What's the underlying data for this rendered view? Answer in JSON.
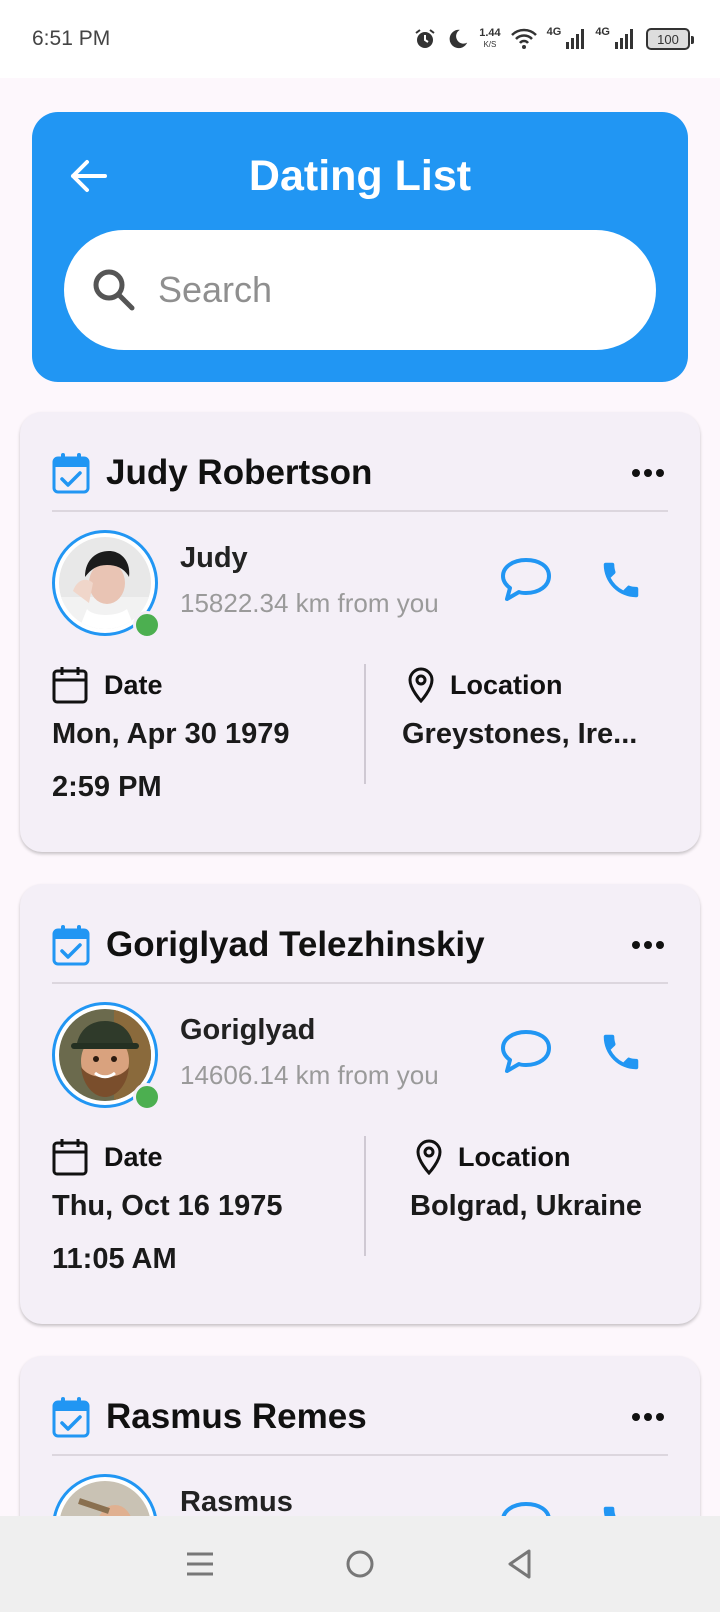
{
  "status_bar": {
    "time": "6:51 PM",
    "speed_value": "1.44",
    "speed_unit": "K/S",
    "net1": "4G",
    "net2": "4G",
    "battery": "100"
  },
  "header": {
    "title": "Dating List",
    "search_placeholder": "Search",
    "color": "#2196f3"
  },
  "labels": {
    "date": "Date",
    "location": "Location"
  },
  "cards": [
    {
      "full_name": "Judy Robertson",
      "first_name": "Judy",
      "distance": "15822.34 km from you",
      "date": "Mon, Apr 30 1979",
      "time": "2:59 PM",
      "location": "Greystones, Ire..."
    },
    {
      "full_name": "Goriglyad Telezhinskiy",
      "first_name": "Goriglyad",
      "distance": "14606.14 km from you",
      "date": "Thu, Oct 16 1975",
      "time": "11:05 AM",
      "location": "Bolgrad, Ukraine"
    },
    {
      "full_name": "Rasmus Remes",
      "first_name": "Rasmus"
    }
  ],
  "colors": {
    "accent": "#2196f3",
    "online": "#4caf50",
    "card_bg": "#f4eff7"
  }
}
